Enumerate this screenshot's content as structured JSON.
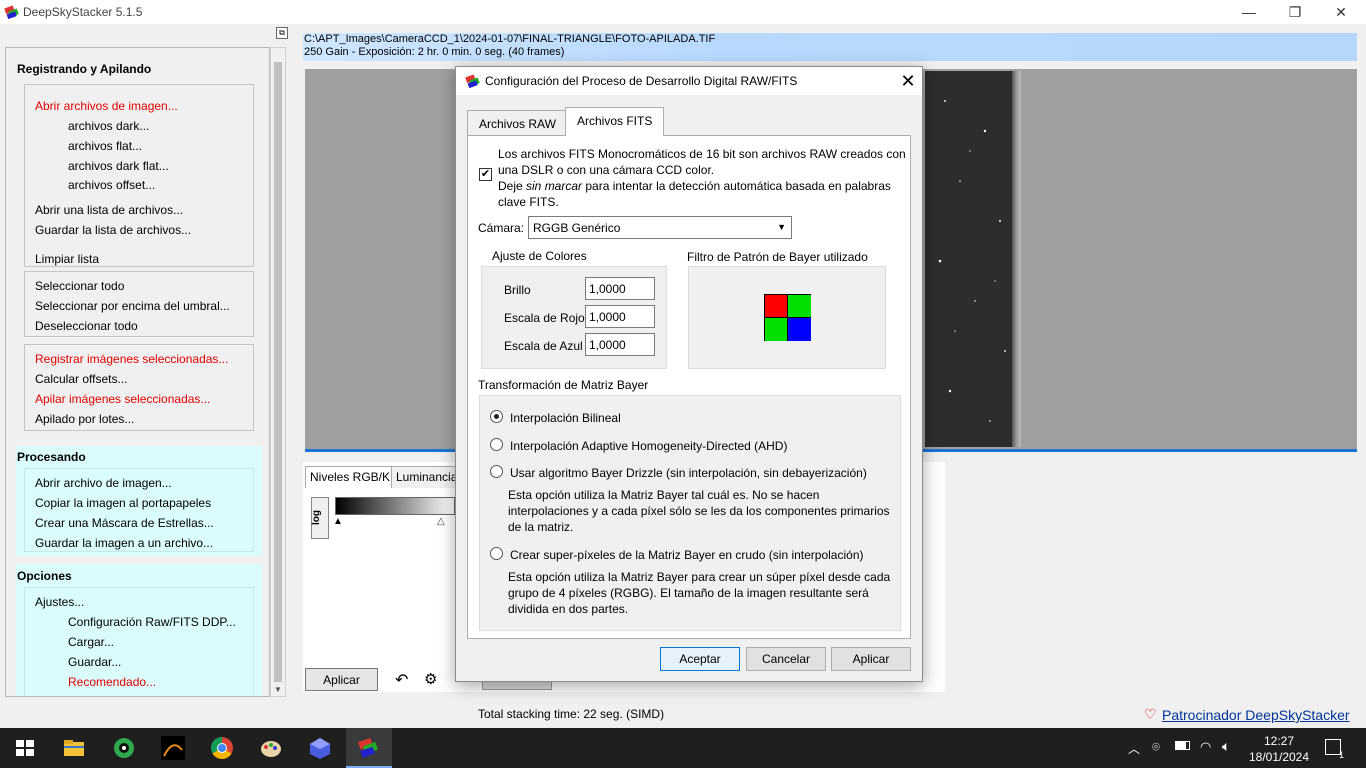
{
  "app": {
    "title": "DeepSkyStacker 5.1.5"
  },
  "window_controls": {
    "minimize": "—",
    "maximize": "❐",
    "close": "✕"
  },
  "left": {
    "section1": {
      "title": "Registrando y Apilando"
    },
    "open_group": [
      {
        "label": "Abrir archivos de imagen...",
        "red": true
      },
      {
        "label": "archivos dark...",
        "indent": true
      },
      {
        "label": "archivos flat...",
        "indent": true
      },
      {
        "label": "archivos dark flat...",
        "indent": true
      },
      {
        "label": "archivos offset...",
        "indent": true
      },
      {
        "label": "Abrir una lista de archivos..."
      },
      {
        "label": "Guardar la lista de archivos..."
      },
      {
        "label": "Limpiar lista"
      }
    ],
    "select_group": [
      {
        "label": "Seleccionar todo"
      },
      {
        "label": "Seleccionar por encima del umbral..."
      },
      {
        "label": "Deseleccionar todo"
      }
    ],
    "register_group": [
      {
        "label": "Registrar imágenes seleccionadas...",
        "red": true
      },
      {
        "label": "Calcular offsets..."
      },
      {
        "label": "Apilar imágenes seleccionadas...",
        "red": true
      },
      {
        "label": "Apilado por lotes..."
      }
    ],
    "section2": {
      "title": "Procesando"
    },
    "process_group": [
      {
        "label": "Abrir archivo de imagen..."
      },
      {
        "label": "Copiar la imagen al portapapeles"
      },
      {
        "label": "Crear una Máscara de Estrellas..."
      },
      {
        "label": "Guardar la imagen a un archivo..."
      }
    ],
    "section3": {
      "title": "Opciones"
    },
    "options_group": [
      {
        "label": "Ajustes..."
      },
      {
        "label": "Configuración Raw/FITS DDP...",
        "indent": true
      },
      {
        "label": "Cargar...",
        "indent": true
      },
      {
        "label": "Guardar...",
        "indent": true
      },
      {
        "label": "Recomendado...",
        "indent": true,
        "red": true
      }
    ]
  },
  "file": {
    "path": "C:\\APT_Images\\CameraCCD_1\\2024-01-07\\FINAL-TRIANGLE\\FOTO-APILADA.TIF",
    "info": "250 Gain - Exposición: 2 hr. 0 min. 0 seg. (40 frames)"
  },
  "lower": {
    "tab1": "Niveles RGB/K",
    "tab2": "Luminancia",
    "log_label": "log",
    "apply_button": "Aplicar",
    "reset_button": "Reinicial"
  },
  "status": {
    "text": "Total stacking time: 22 seg.  (SIMD)"
  },
  "sponsor": {
    "label": "Patrocinador DeepSkyStacker"
  },
  "dialog": {
    "title": "Configuración del Proceso de Desarrollo Digital RAW/FITS",
    "tabs": [
      {
        "label": "Archivos RAW"
      },
      {
        "label": "Archivos FITS"
      }
    ],
    "active_tab": 1,
    "fits_checkbox": {
      "checked": true,
      "line1": "Los archivos FITS Monocromáticos de 16 bit son archivos RAW creados con",
      "line2": "una DSLR o con una cámara CCD color.",
      "line3a": "Deje ",
      "line3b": "sin marcar",
      "line3c": " para intentar la detección automática basada en palabras",
      "line4": "clave FITS."
    },
    "camera": {
      "label": "Cámara:",
      "value": "RGGB Genérico"
    },
    "color_adjust": {
      "title": "Ajuste de Colores",
      "brightness_label": "Brillo",
      "brightness": "1,0000",
      "red_label": "Escala de Rojo",
      "red": "1,0000",
      "blue_label": "Escala de Azul",
      "blue": "1,0000"
    },
    "bayer_filter": {
      "title": "Filtro de Patrón de Bayer utilizado",
      "colors": [
        "#ff0000",
        "#00e000",
        "#00e000",
        "#0000ff"
      ]
    },
    "bayer_transform": {
      "title": "Transformación de Matriz Bayer",
      "selected": 0,
      "options": [
        {
          "label": "Interpolación Bilineal"
        },
        {
          "label": "Interpolación Adaptive Homogeneity-Directed (AHD)"
        },
        {
          "label": "Usar algoritmo Bayer Drizzle (sin interpolación, sin debayerización)",
          "desc": [
            "Esta opción utiliza la Matriz Bayer tal cuál es. No se hacen",
            "interpolaciones y a cada píxel sólo se les da los componentes primarios",
            "de la matriz."
          ]
        },
        {
          "label": "Crear super-píxeles de la Matriz Bayer en crudo (sin interpolación)",
          "desc": [
            "Esta opción utiliza la Matriz Bayer para crear un súper píxel desde cada",
            "grupo de 4 píxeles (RGBG). El tamaño de la imagen resultante será",
            "dividida en dos partes."
          ]
        }
      ]
    },
    "buttons": {
      "ok": "Aceptar",
      "cancel": "Cancelar",
      "apply": "Aplicar"
    }
  },
  "taskbar": {
    "time": "12:27",
    "date": "18/01/2024",
    "notifications": "1"
  }
}
